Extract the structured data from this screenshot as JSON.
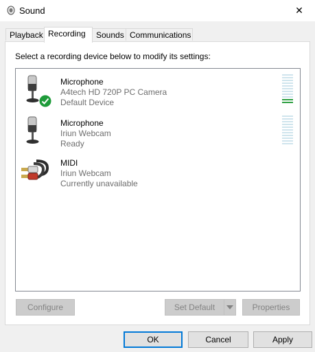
{
  "window": {
    "title": "Sound",
    "close_glyph": "✕"
  },
  "tabs": [
    {
      "label": "Playback",
      "active": false
    },
    {
      "label": "Recording",
      "active": true
    },
    {
      "label": "Sounds",
      "active": false
    },
    {
      "label": "Communications",
      "active": false
    }
  ],
  "instruction": "Select a recording device below to modify its settings:",
  "devices": [
    {
      "icon": "microphone-icon",
      "name": "Microphone",
      "description": "A4tech HD 720P PC Camera",
      "status": "Default Device",
      "default_badge": "check-icon",
      "meter_level": 0.15
    },
    {
      "icon": "microphone-icon",
      "name": "Microphone",
      "description": "Iriun Webcam",
      "status": "Ready",
      "meter_level": 0
    },
    {
      "icon": "rca-cable-icon",
      "name": "MIDI",
      "description": "Iriun Webcam",
      "status": "Currently unavailable"
    }
  ],
  "buttons": {
    "configure": "Configure",
    "set_default": "Set Default",
    "properties": "Properties",
    "ok": "OK",
    "cancel": "Cancel",
    "apply": "Apply"
  },
  "colors": {
    "accent": "#0078d7",
    "check_green": "#1e9b3a",
    "meter_active": "#2ea043",
    "meter_idle": "#cfe4ed"
  }
}
